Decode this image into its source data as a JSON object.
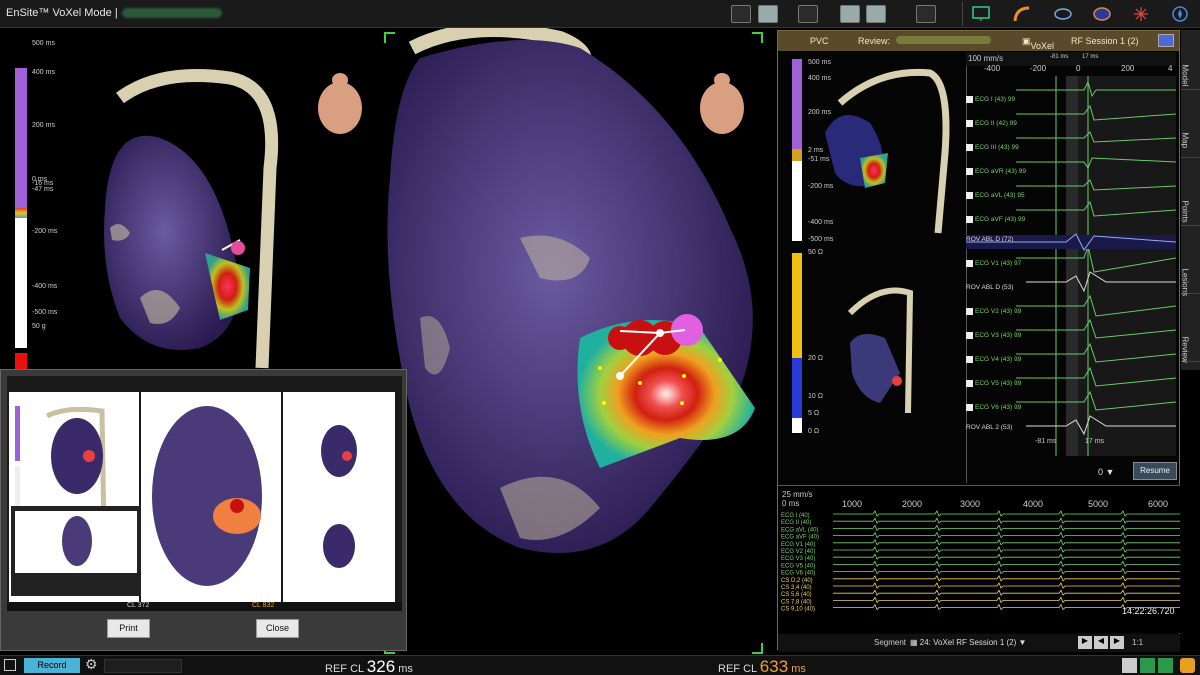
{
  "topbar": {
    "title": "EnSite™ VoXel Mode |"
  },
  "left_scale": {
    "labels": [
      "500 ms",
      "400 ms",
      "200 ms",
      "0 ms",
      "-16 ms",
      "-47 ms",
      "-200 ms",
      "-400 ms",
      "-500 ms",
      "50 g"
    ]
  },
  "panel": {
    "mode": "PVC",
    "review_label": "Review:",
    "voxel": "VoXel",
    "session": "RF Session 1 (2)",
    "scale_top": [
      "500 ms",
      "400 ms",
      "200 ms",
      "2 ms",
      "-51 ms",
      "-200 ms",
      "-400 ms",
      "-500 ms"
    ],
    "scale_bottom": [
      "50 Ω",
      "20 Ω",
      "10 Ω",
      "5 Ω",
      "0 Ω"
    ],
    "speed": "100 mm/s",
    "timeline": [
      "-400",
      "-200",
      "0",
      "200",
      "4"
    ],
    "marker_left": "-81 ms",
    "marker_right": "17 ms",
    "ecg_rows": [
      {
        "label": "ECG I (43)",
        "val": "99",
        "check": true
      },
      {
        "label": "ECG II (42)",
        "val": "99",
        "check": true
      },
      {
        "label": "ECG III (43)",
        "val": "99",
        "check": true
      },
      {
        "label": "ECG aVR (43)",
        "val": "99",
        "check": true
      },
      {
        "label": "ECG aVL (43)",
        "val": "95",
        "check": true
      },
      {
        "label": "ECG aVF (43)",
        "val": "99",
        "check": true
      },
      {
        "label": "ROV ABL D (72)",
        "val": "",
        "check": false
      },
      {
        "label": "ECG V1 (43)",
        "val": "97",
        "check": true
      },
      {
        "label": "ROV ABL D (53)",
        "val": "",
        "check": false
      },
      {
        "label": "ECG V2 (43)",
        "val": "99",
        "check": true
      },
      {
        "label": "ECG V3 (43)",
        "val": "99",
        "check": true
      },
      {
        "label": "ECG V4 (43)",
        "val": "99",
        "check": true
      },
      {
        "label": "ECG V5 (43)",
        "val": "99",
        "check": true
      },
      {
        "label": "ECG V6 (43)",
        "val": "99",
        "check": true
      },
      {
        "label": "ROV ABL 2 (53)",
        "val": "",
        "check": false
      }
    ],
    "bottom_left": "-81 ms",
    "bottom_right": "17 ms",
    "dropdown_value": "0",
    "resume": "Resume",
    "tabs": [
      "Model",
      "Map",
      "Points",
      "Lesions",
      "Review"
    ]
  },
  "strip": {
    "speed": "25 mm/s",
    "start": "0 ms",
    "ticks": [
      "1000",
      "2000",
      "3000",
      "4000",
      "5000",
      "6000"
    ],
    "leads": [
      "ECG I (40)",
      "ECG II (40)",
      "ECG aVL (40)",
      "ECG aVF (40)",
      "ECG V1 (40)",
      "ECG V2 (40)",
      "ECG V3 (40)",
      "ECG V5 (40)",
      "ECG V6 (40)",
      "CS D,2 (40)",
      "CS 3,4 (40)",
      "CS 5,6 (40)",
      "CS 7,8 (40)",
      "CS 9,10 (40)"
    ],
    "time": "14:22:26.720"
  },
  "segment": {
    "label": "Segment",
    "value": "24: VoXel RF Session 1 (2)",
    "zoom": "1:1"
  },
  "bottombar": {
    "record": "Record",
    "ref1": "REF",
    "cl1": "CL",
    "val1": "326",
    "unit1": "ms",
    "ref2": "REF",
    "cl2": "CL",
    "val2": "633",
    "unit2": "ms"
  },
  "dialog": {
    "print": "Print",
    "close": "Close",
    "mini_cl": "CL",
    "mini_cl_val": "372",
    "mini_cl2_val": "832"
  }
}
